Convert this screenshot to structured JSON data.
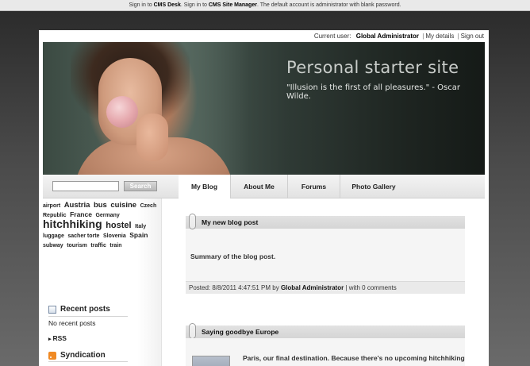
{
  "topbar": {
    "sign_in_1": "Sign in to ",
    "cms_desk": "CMS Desk",
    "sign_in_2": ". Sign in to ",
    "site_manager": "CMS Site Manager",
    "note": ". The default account is administrator with blank password."
  },
  "userbar": {
    "current_user_label": "Current user:",
    "user_name": "Global Administrator",
    "my_details": "My details",
    "sign_out": "Sign out"
  },
  "banner": {
    "site_title": "Personal starter site",
    "quote": "\"Illusion is the first of all pleasures.\" - Oscar Wilde."
  },
  "search": {
    "value": "",
    "button_label": "Search"
  },
  "menu": {
    "items": [
      {
        "label": "My Blog"
      },
      {
        "label": "About Me"
      },
      {
        "label": "Forums"
      },
      {
        "label": "Photo Gallery"
      }
    ]
  },
  "tagcloud": {
    "tags": [
      {
        "label": "airport"
      },
      {
        "label": "Austria"
      },
      {
        "label": "bus"
      },
      {
        "label": "cuisine"
      },
      {
        "label": "Czech Republic"
      },
      {
        "label": "France"
      },
      {
        "label": "Germany"
      },
      {
        "label": "hitchhiking"
      },
      {
        "label": "hostel"
      },
      {
        "label": "Italy"
      },
      {
        "label": "luggage"
      },
      {
        "label": "sacher torte"
      },
      {
        "label": "Slovenia"
      },
      {
        "label": "Spain"
      },
      {
        "label": "subway"
      },
      {
        "label": "tourism"
      },
      {
        "label": "traffic"
      },
      {
        "label": "train"
      }
    ]
  },
  "recent_posts": {
    "title": "Recent posts",
    "empty_text": "No recent posts"
  },
  "syndication": {
    "title": "Syndication",
    "rss_label": "RSS"
  },
  "posts": [
    {
      "title": "My new blog post",
      "summary": "Summary of the blog post.",
      "posted_prefix": "Posted: 8/8/2011 4:47:51 PM by ",
      "author": "Global Administrator",
      "comments": " | with 0 comments"
    },
    {
      "title": "Saying goodbye Europe",
      "excerpt": "Paris, our final destination. Because there's no upcoming hitchhiking"
    }
  ],
  "colors": {
    "accent_rss": "#f08a24",
    "banner_title": "#c9cdca"
  }
}
